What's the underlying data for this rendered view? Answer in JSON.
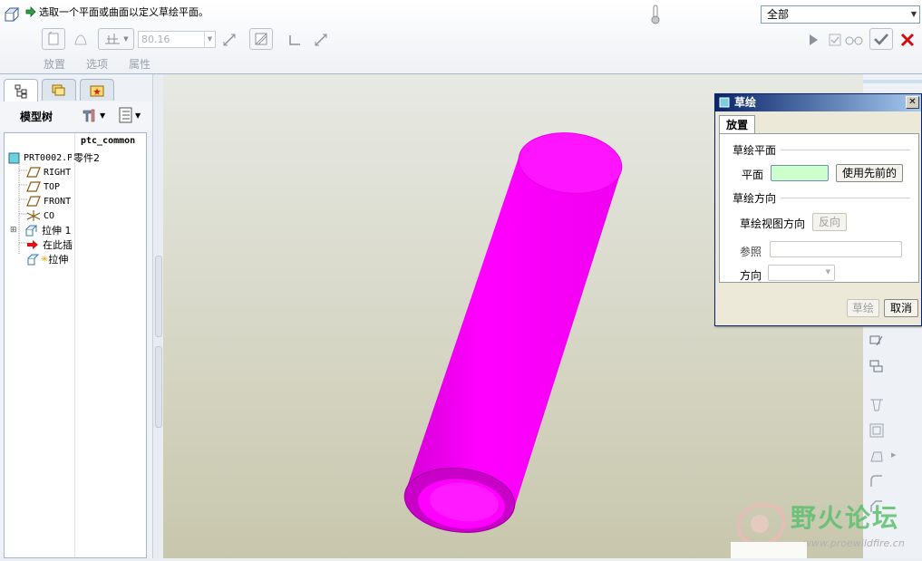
{
  "dashboard": {
    "message": "选取一个平面或曲面以定义草绘平面。",
    "filter_value": "全部",
    "depth_value": "80.16",
    "tabs": [
      "放置",
      "选项",
      "属性"
    ]
  },
  "model_tree": {
    "title": "模型树",
    "column_header": "ptc_common",
    "items": [
      {
        "label": "PRT0002.P",
        "col": "零件2",
        "icon": "part-icon"
      },
      {
        "label": "RIGHT",
        "icon": "datum-plane-icon"
      },
      {
        "label": "TOP",
        "icon": "datum-plane-icon"
      },
      {
        "label": "FRONT",
        "icon": "datum-plane-icon"
      },
      {
        "label": "CO",
        "icon": "coordinate-system-icon"
      },
      {
        "label": "拉伸 1",
        "icon": "extrude-icon"
      },
      {
        "label": "在此插",
        "icon": "insert-here-arrow-icon"
      },
      {
        "label": "拉伸",
        "icon": "extrude-icon"
      }
    ]
  },
  "sketch_dialog": {
    "title": "草绘",
    "tab": "放置",
    "sketch_plane_group": "草绘平面",
    "plane_label": "平面",
    "use_previous_button": "使用先前的",
    "orientation_group": "草绘方向",
    "view_direction_label": "草绘视图方向",
    "flip_button": "反向",
    "reference_label": "参照",
    "direction_label": "方向",
    "sketch_button": "草绘",
    "cancel_button": "取消"
  },
  "watermark": {
    "text": "野火论坛",
    "url": "www.proewildfire.cn"
  },
  "colors": {
    "model": "#ff00ff",
    "plane_field": "#ccffcc",
    "accent": "#0a246a"
  }
}
